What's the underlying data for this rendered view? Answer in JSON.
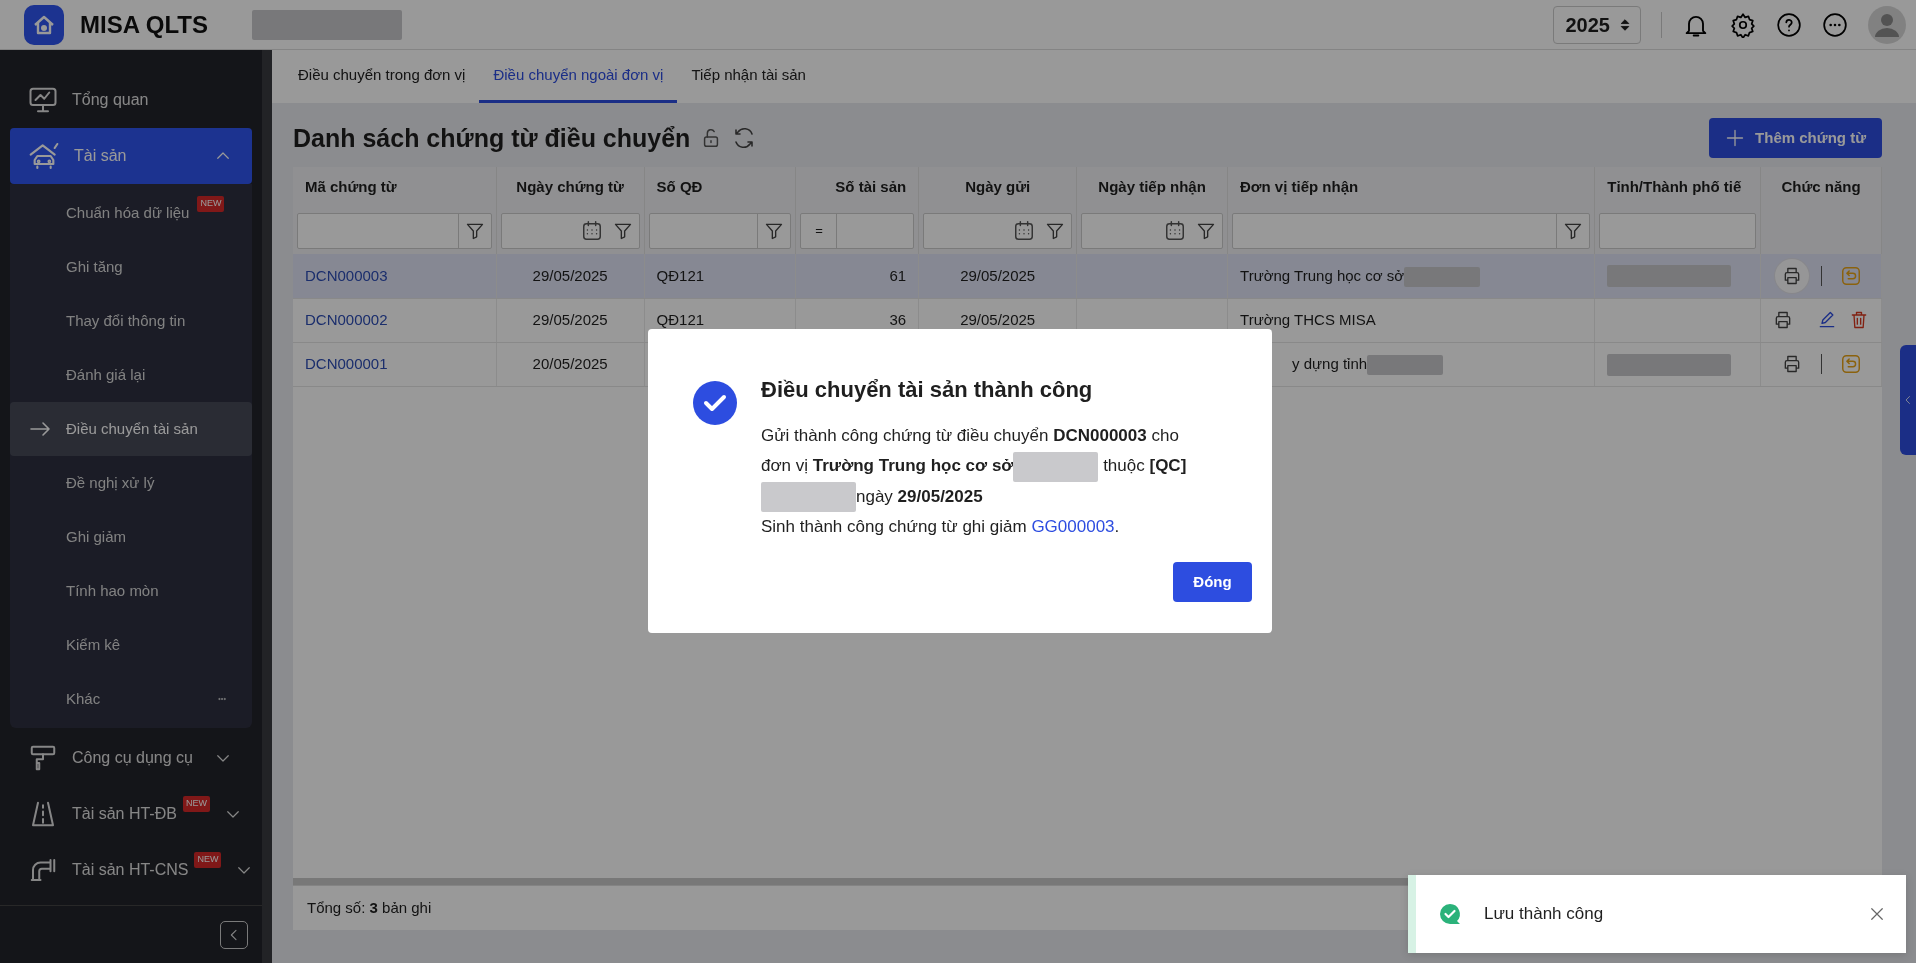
{
  "app": {
    "name": "MISA QLTS"
  },
  "header": {
    "org_redacted": true,
    "year": "2025"
  },
  "sidebar": {
    "items": [
      {
        "label": "Tổng quan",
        "selected": false
      },
      {
        "label": "Tài sản",
        "selected": true,
        "expanded": true,
        "children": [
          {
            "label": "Chuẩn hóa dữ liệu",
            "badge": "NEW",
            "selected": false
          },
          {
            "label": "Ghi tăng",
            "selected": false
          },
          {
            "label": "Thay đổi thông tin",
            "selected": false
          },
          {
            "label": "Đánh giá lại",
            "selected": false
          },
          {
            "label": "Điều chuyển tài sản",
            "selected": true
          },
          {
            "label": "Đề nghị xử lý",
            "selected": false
          },
          {
            "label": "Ghi giảm",
            "selected": false
          },
          {
            "label": "Tính hao mòn",
            "selected": false
          },
          {
            "label": "Kiểm kê",
            "selected": false
          },
          {
            "label": "Khác",
            "selected": false,
            "has_more": true
          }
        ]
      },
      {
        "label": "Công cụ dụng cụ",
        "selected": false,
        "expanded": false
      },
      {
        "label": "Tài sản HT-ĐB",
        "badge": "NEW",
        "selected": false,
        "expanded": false
      },
      {
        "label": "Tài sản HT-CNS",
        "badge": "NEW",
        "selected": false,
        "expanded": false
      }
    ]
  },
  "tabs": [
    {
      "label": "Điều chuyển trong đơn vị",
      "selected": false
    },
    {
      "label": "Điều chuyển ngoài đơn vị",
      "selected": true
    },
    {
      "label": "Tiếp nhận tài sản",
      "selected": false
    }
  ],
  "page": {
    "title": "Danh sách chứng từ điều chuyển",
    "add_button": "Thêm chứng từ"
  },
  "table": {
    "columns": [
      {
        "label": "Mã chứng từ",
        "kind": "text"
      },
      {
        "label": "Ngày chứng từ",
        "kind": "date"
      },
      {
        "label": "Số QĐ",
        "kind": "text"
      },
      {
        "label": "Số tài sản",
        "kind": "number",
        "operator": "="
      },
      {
        "label": "Ngày gửi",
        "kind": "date"
      },
      {
        "label": "Ngày tiếp nhận",
        "kind": "date"
      },
      {
        "label": "Đơn vị tiếp nhận",
        "kind": "text"
      },
      {
        "label": "Tỉnh/Thành phố tiế",
        "kind": "plain"
      },
      {
        "label": "Chức năng",
        "kind": "none"
      }
    ],
    "rows": [
      {
        "selected": true,
        "code": "DCN000003",
        "doc_date": "29/05/2025",
        "decision_no": "QĐ121",
        "asset_count": "61",
        "sent_date": "29/05/2025",
        "receiver": "Trường Trung học cơ sở",
        "receiver_redacted": true,
        "province_redacted": true,
        "actions": [
          {
            "kind": "print",
            "hovered": true
          },
          {
            "kind": "restore"
          }
        ]
      },
      {
        "selected": false,
        "code": "DCN000002",
        "doc_date": "29/05/2025",
        "decision_no": "QĐ121",
        "asset_count": "36",
        "sent_date": "29/05/2025",
        "receiver": "Trường THCS MISA",
        "receiver_redacted": false,
        "province_redacted": false,
        "actions": [
          {
            "kind": "print",
            "hovered": false
          },
          {
            "kind": "edit"
          },
          {
            "kind": "delete"
          }
        ]
      },
      {
        "selected": false,
        "code": "DCN000001",
        "doc_date": "20/05/2025",
        "receiver": "y dựng tỉnh",
        "receiver_redacted": true,
        "province_redacted": true,
        "actions": [
          {
            "kind": "print",
            "hovered": false
          },
          {
            "kind": "restore"
          }
        ]
      }
    ],
    "footer": "Tổng số: **3** bản ghi"
  },
  "modal": {
    "title": "Điều chuyển tài sản thành công",
    "message": [
      {
        "kind": "text",
        "text": "Gửi thành công chứng từ điều chuyển **DCN000003** cho đơn vị **Trường Trung học cơ sở**"
      },
      {
        "kind": "redacted"
      },
      {
        "kind": "text",
        "text": " thuộc **[QC]** "
      },
      {
        "kind": "redacted"
      },
      {
        "kind": "text",
        "text": "ngày **29/05/2025**"
      }
    ],
    "note": {
      "text": "Sinh thành công chứng từ ghi giảm ",
      "link": "GG000003",
      "end": "."
    },
    "button": "Đóng"
  },
  "toast": {
    "message": "Lưu thành công"
  }
}
